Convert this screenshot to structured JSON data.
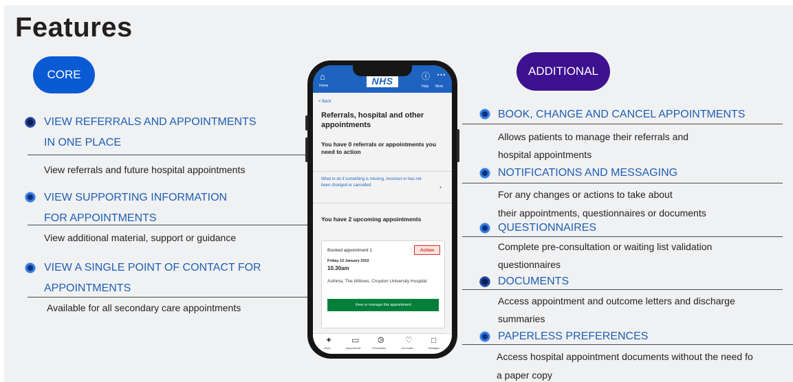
{
  "title": "Features",
  "core": {
    "pill": "CORE",
    "items": [
      {
        "heading_line1": "VIEW REFERRALS AND APPOINTMENTS",
        "heading_line2": "IN ONE PLACE",
        "description": "View referrals and future hospital appointments"
      },
      {
        "heading_line1": "VIEW SUPPORTING INFORMATION",
        "heading_line2": "FOR APPOINTMENTS",
        "description": "View additional material, support or guidance"
      },
      {
        "heading_line1": "VIEW A SINGLE POINT OF CONTACT FOR",
        "heading_line2": "APPOINTMENTS",
        "description": "Available for all secondary care appointments"
      }
    ]
  },
  "additional": {
    "pill": "ADDITIONAL",
    "items": [
      {
        "heading": "BOOK, CHANGE AND CANCEL APPOINTMENTS",
        "description_line1": "Allows patients to manage their referrals and",
        "description_line2": "hospital appointments"
      },
      {
        "heading": "NOTIFICATIONS AND MESSAGING",
        "description_line1": "For any changes or actions to take about",
        "description_line2": "their appointments, questionnaires or documents"
      },
      {
        "heading": "QUESTIONNAIRES",
        "description_line1": "Complete pre-consultation or waiting list validation",
        "description_line2": "questionnaires"
      },
      {
        "heading": "DOCUMENTS",
        "description_line1": "Access appointment and outcome letters and discharge",
        "description_line2": "summaries"
      },
      {
        "heading": "PAPERLESS PREFERENCES",
        "description_line1": "Access hospital appointment documents without the need fo",
        "description_line2": "a paper copy"
      }
    ]
  },
  "phone": {
    "header": {
      "home_label": "Home",
      "logo": "NHS",
      "help_label": "Help",
      "more_label": "More"
    },
    "back": "< Back",
    "title": "Referrals, hospital and other appointments",
    "referrals_status": "You have 0 referrals or appointments you need to action",
    "missing_link": "What to do if something is missing, incorrect or has not been changed or cancelled",
    "upcoming_status": "You have 2 upcoming appointments",
    "card": {
      "title": "Booked appointment 1",
      "tag": "Action",
      "date": "Friday 12 January 2022",
      "time": "10.30am",
      "location": "Asthma, The Willows, Croydon University Hospital",
      "button": "View or manage this appointment"
    },
    "tabs": [
      {
        "label": "Home",
        "icon": "stethoscope-icon"
      },
      {
        "label": "Appointments",
        "icon": "tablet-icon"
      },
      {
        "label": "Prescriptions",
        "icon": "pill-icon"
      },
      {
        "label": "Your health",
        "icon": "heart-icon"
      },
      {
        "label": "Messages",
        "icon": "message-icon"
      }
    ]
  },
  "colors": {
    "core_pill": "#0a5bd3",
    "additional_pill": "#3d1190",
    "heading": "#1f5fb6",
    "nhs_blue": "#1e63bf",
    "nhs_green": "#007f3b"
  }
}
